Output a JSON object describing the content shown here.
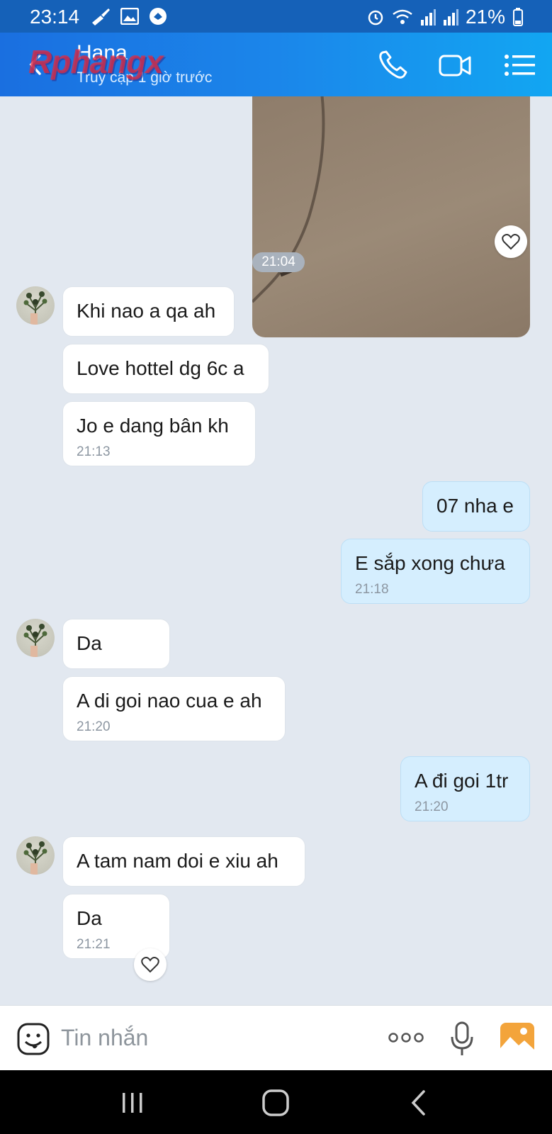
{
  "status_bar": {
    "time": "23:14",
    "battery": "21%"
  },
  "header": {
    "contact_name": "Hana",
    "contact_status": "Truy cập 1 giờ trước",
    "watermark": "Rphangx"
  },
  "chat": {
    "photo_time": "21:04",
    "messages": [
      {
        "dir": "in",
        "text": "Khi nao a qa ah",
        "time": ""
      },
      {
        "dir": "in",
        "text": "Love hottel dg 6c a",
        "time": ""
      },
      {
        "dir": "in",
        "text": "Jo e dang bân kh",
        "time": "21:13"
      },
      {
        "dir": "out",
        "text": "07 nha e",
        "time": ""
      },
      {
        "dir": "out",
        "text": "E sắp xong chưa",
        "time": "21:18"
      },
      {
        "dir": "in",
        "text": "Da",
        "time": ""
      },
      {
        "dir": "in",
        "text": "A di goi nao cua e ah",
        "time": "21:20"
      },
      {
        "dir": "out",
        "text": "A đi goi 1tr",
        "time": "21:20"
      },
      {
        "dir": "in",
        "text": "A tam nam doi e xiu ah",
        "time": ""
      },
      {
        "dir": "in",
        "text": "Da",
        "time": "21:21"
      }
    ]
  },
  "input_bar": {
    "placeholder": "Tin nhắn"
  },
  "colors": {
    "header_start": "#1a6fe0",
    "header_end": "#12a6f2",
    "outgoing_bubble": "#d5eefe",
    "chat_bg": "#e2e8f0"
  }
}
